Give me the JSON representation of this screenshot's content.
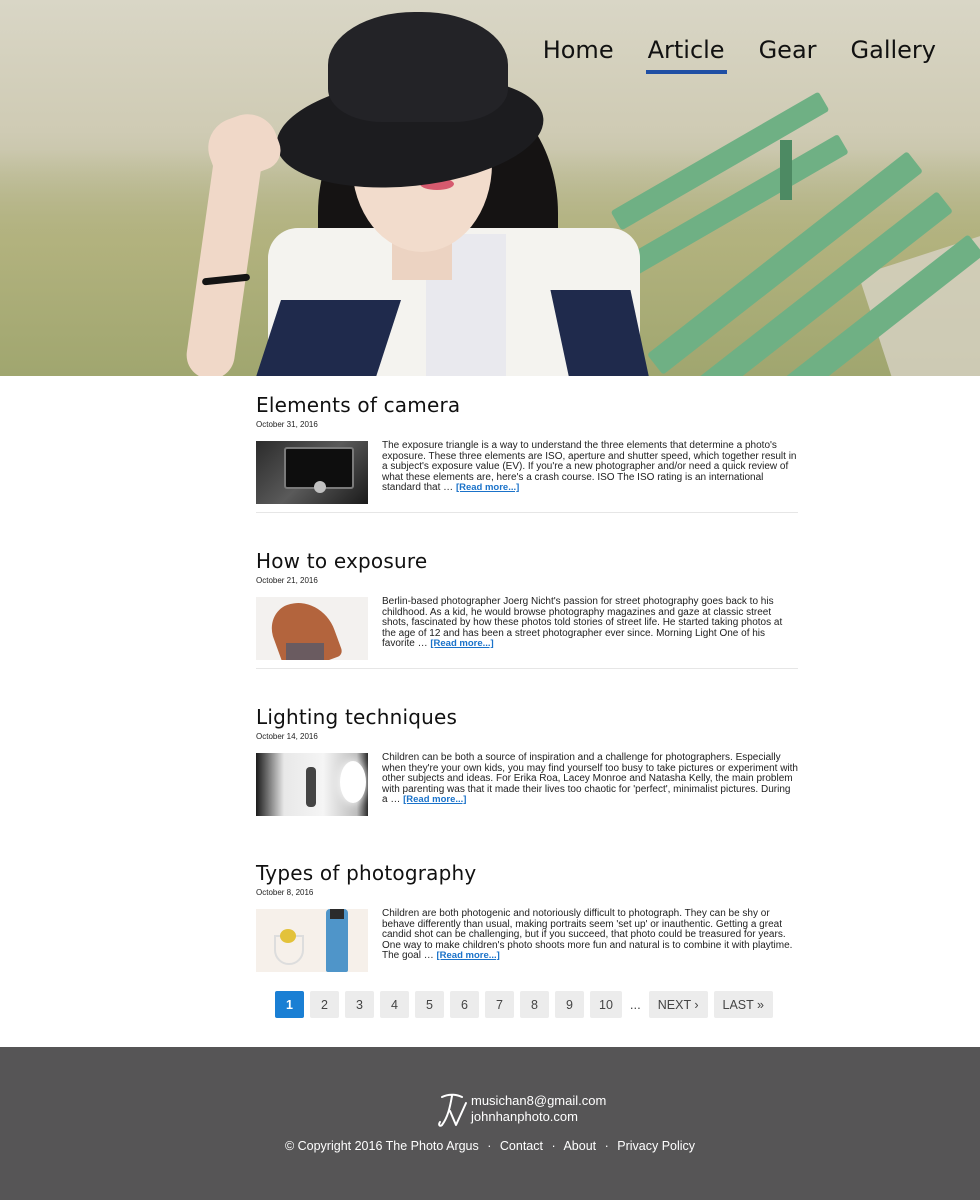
{
  "nav": {
    "items": [
      {
        "label": "Home"
      },
      {
        "label": "Article"
      },
      {
        "label": "Gear"
      },
      {
        "label": "Gallery"
      }
    ],
    "active": "Article",
    "accent_color": "#1f4fa4"
  },
  "articles": [
    {
      "title": "Elements of camera",
      "date": "October 31, 2016",
      "excerpt": "The exposure triangle is a way to understand the three elements that determine a photo's exposure. These three elements are ISO, aperture and shutter speed, which together result in a subject's exposure value (EV). If you're a new photographer and/or need a quick review of what these elements are, here's a crash course. ISO The ISO rating is an international standard that …",
      "read_more": "[Read more...]",
      "thumb": "camera-screen"
    },
    {
      "title": "How to exposure",
      "date": "October 21, 2016",
      "excerpt": "Berlin-based photographer Joerg Nicht's passion for street photography goes back to his childhood. As a kid, he would browse photography magazines and gaze at classic street shots, fascinated by how these photos told stories of street life. He started taking photos at the age of 12 and has been a street photographer ever since. Morning Light One of his favorite …",
      "read_more": "[Read more...]",
      "thumb": "red-hair-woman"
    },
    {
      "title": "Lighting techniques",
      "date": "October 14, 2016",
      "excerpt": "Children can be both a source of inspiration and a challenge for photographers. Especially when they're your own kids, you may find yourself too busy to take pictures or experiment with other subjects and ideas. For Erika Roa, Lacey Monroe and Natasha Kelly, the main problem with parenting was that it made their lives too chaotic for 'perfect', minimalist pictures. During a …",
      "read_more": "[Read more...]",
      "thumb": "studio-lighting"
    },
    {
      "title": "Types of photography",
      "date": "October 8, 2016",
      "excerpt": "Children are both photogenic and notoriously difficult to photograph. They can be shy or behave differently than usual, making portraits seem 'set up' or inauthentic. Getting a great candid shot can be challenging, but if you succeed, that photo could be treasured for years. One way to make children's photo shoots more fun and natural is to combine it with playtime. The goal …",
      "read_more": "[Read more...]",
      "thumb": "still-life-bottle"
    }
  ],
  "pagination": {
    "pages": [
      "1",
      "2",
      "3",
      "4",
      "5",
      "6",
      "7",
      "8",
      "9",
      "10"
    ],
    "current": "1",
    "ellipsis": "...",
    "next": "NEXT ›",
    "last": "LAST »",
    "active_color": "#1a7fd4"
  },
  "footer": {
    "email": "musichan8@gmail.com",
    "site": "johnhanphoto.com",
    "copyright": "© Copyright 2016 The Photo Argus",
    "links": [
      "Contact",
      "About",
      "Privacy Policy"
    ],
    "separator": "·",
    "background": "#565556"
  }
}
